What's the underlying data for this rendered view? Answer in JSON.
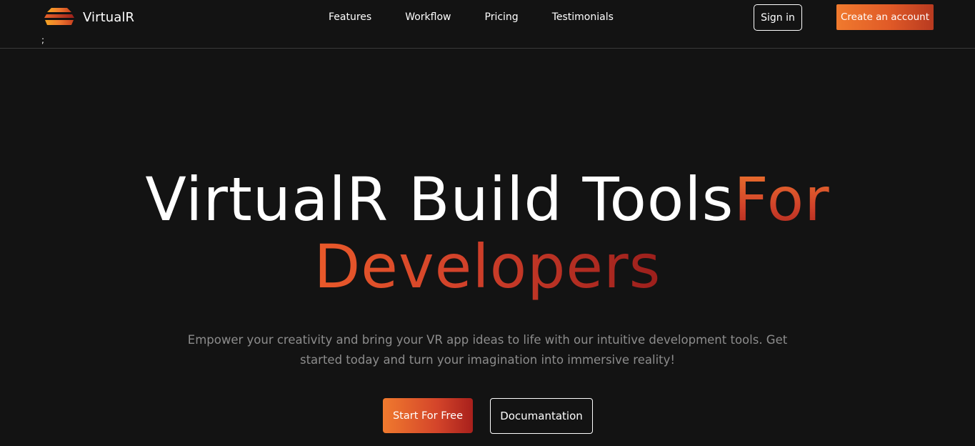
{
  "brand": {
    "name": "VirtualR",
    "logo_icon": "stacked-layers-logo-icon"
  },
  "stray_text": ";",
  "nav": {
    "links": [
      "Features",
      "Workflow",
      "Pricing",
      "Testimonials"
    ]
  },
  "auth": {
    "signin_label": "Sign in",
    "create_label": "Create an account"
  },
  "hero": {
    "title_part1": "VirtualR Build Tools",
    "title_part2": "For",
    "title_part3": "Developers",
    "subtitle": "Empower your creativity and bring your VR app ideas to life with our intuitive development tools. Get started today and turn your imagination into immersive reality!",
    "primary_cta": "Start For Free",
    "secondary_cta": "Documantation"
  },
  "colors": {
    "background": "#131313",
    "accent_start": "#f07a2e",
    "accent_end": "#a8201c",
    "muted_text": "#8c8c8c"
  }
}
